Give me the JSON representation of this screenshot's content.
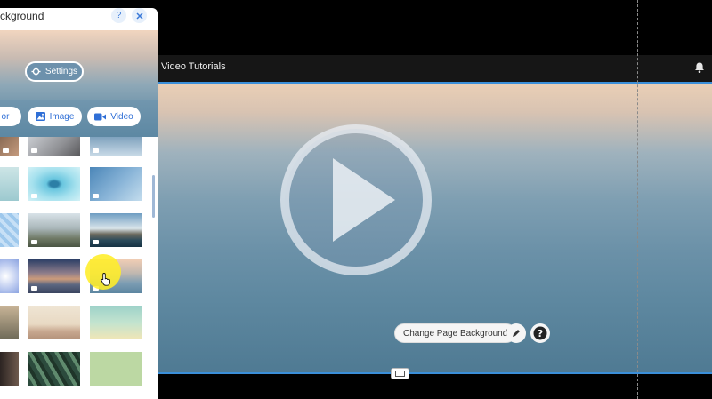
{
  "topbar": {
    "title": "Video Tutorials"
  },
  "canvas": {
    "change_background_label": "Change Page Background",
    "icons": [
      "play-icon",
      "pen-icon",
      "help-icon",
      "bell-icon"
    ]
  },
  "panel": {
    "title": "ckground",
    "settings_label": "Settings",
    "tabs": [
      {
        "label": "or",
        "icon": "color-icon"
      },
      {
        "label": "Image",
        "icon": "image-icon"
      },
      {
        "label": "Video",
        "icon": "video-camera-icon"
      }
    ]
  },
  "colors": {
    "accent": "#2f6fd6",
    "selection": "#3b8fd9",
    "cursor_highlight": "#ffee28"
  }
}
